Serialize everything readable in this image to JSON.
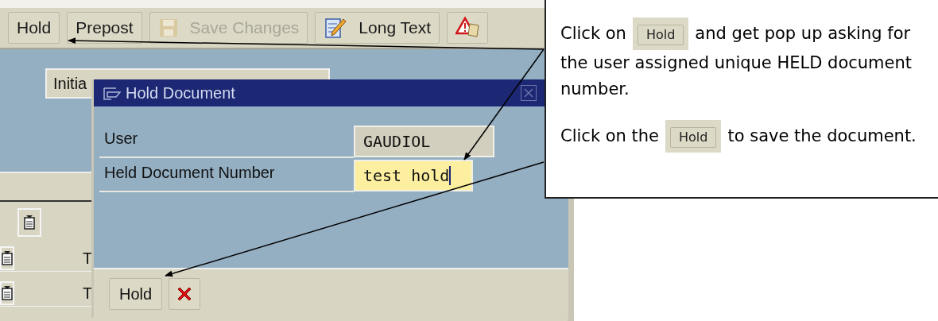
{
  "toolbar": {
    "buttons": [
      {
        "kind": "text",
        "label": "Hold",
        "disabled": false
      },
      {
        "kind": "text",
        "label": "Prepost",
        "disabled": false
      },
      {
        "kind": "save",
        "label": "Save Changes",
        "disabled": true
      },
      {
        "kind": "edit",
        "label": "Long Text",
        "disabled": false
      },
      {
        "kind": "warning",
        "disabled": false
      }
    ]
  },
  "background_tab": {
    "label": "Initia"
  },
  "background_rows": [
    {
      "label": "T"
    },
    {
      "label": "T"
    }
  ],
  "dialog": {
    "title": "Hold Document",
    "fields": [
      {
        "label": "User",
        "value": "GAUDIOL",
        "editable": false
      },
      {
        "label": "Held Document Number",
        "value": "test hold",
        "editable": true
      }
    ],
    "buttons": [
      {
        "kind": "text",
        "label": "Hold"
      },
      {
        "kind": "cancel"
      }
    ]
  },
  "callout": {
    "paragraphs": [
      {
        "before": "Click on",
        "button": "Hold",
        "after": "and get pop up asking for the user assigned unique HELD document number."
      },
      {
        "before": "Click on the",
        "button": "Hold",
        "after": "to save the document."
      }
    ]
  }
}
